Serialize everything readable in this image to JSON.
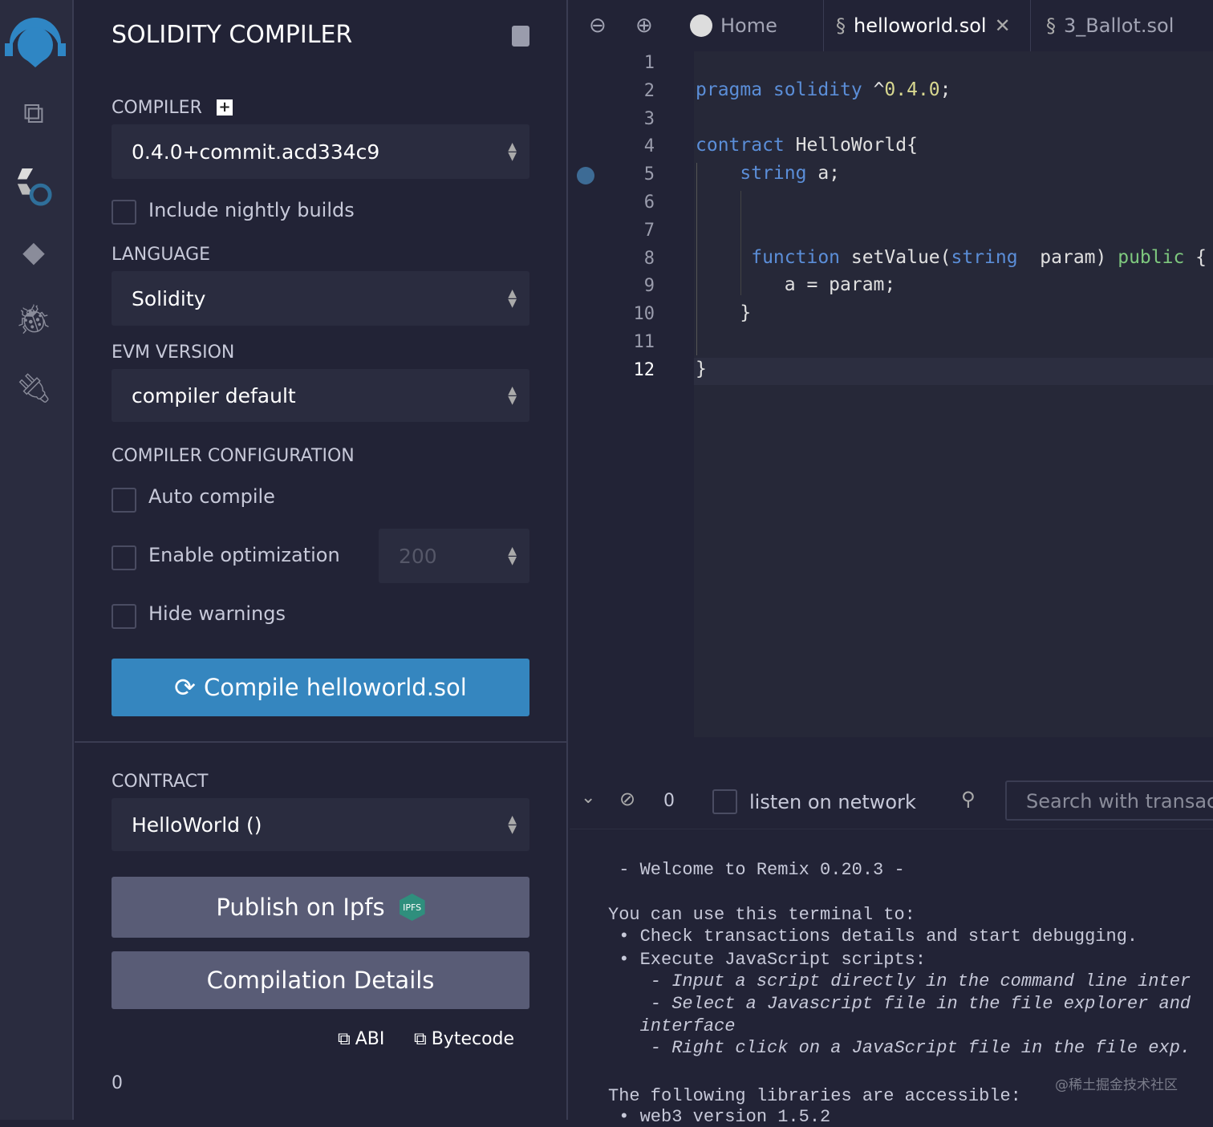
{
  "panel": {
    "title": "SOLIDITY COMPILER",
    "compiler_label": "COMPILER",
    "compiler_value": "0.4.0+commit.acd334c9",
    "nightly_label": "Include nightly builds",
    "language_label": "LANGUAGE",
    "language_value": "Solidity",
    "evm_label": "EVM VERSION",
    "evm_value": "compiler default",
    "config_label": "COMPILER CONFIGURATION",
    "auto_compile": "Auto compile",
    "enable_opt": "Enable optimization",
    "opt_runs": "200",
    "hide_warnings": "Hide warnings",
    "compile_button": "Compile helloworld.sol",
    "contract_label": "CONTRACT",
    "contract_value": "HelloWorld ()",
    "publish_button": "Publish on Ipfs",
    "ipfs_badge": "IPFS",
    "details_button": "Compilation Details",
    "abi_label": "ABI",
    "bytecode_label": "Bytecode",
    "bottom_count": "0"
  },
  "tabs": [
    {
      "label": "Home"
    },
    {
      "label": "helloworld.sol"
    },
    {
      "label": "3_Ballot.sol"
    }
  ],
  "colors": {
    "keyword": "#5b8ed8",
    "number": "#d8d890",
    "public": "#7ec87e",
    "accent": "#3586bf"
  },
  "code": [
    {
      "n": "1",
      "tokens": []
    },
    {
      "n": "2",
      "tokens": [
        {
          "t": "pragma solidity ",
          "k": "keyword"
        },
        {
          "t": "^",
          "k": "plain"
        },
        {
          "t": "0.4.0",
          "k": "number"
        },
        {
          "t": ";",
          "k": "plain"
        }
      ]
    },
    {
      "n": "3",
      "tokens": []
    },
    {
      "n": "4",
      "tokens": [
        {
          "t": "contract ",
          "k": "keyword"
        },
        {
          "t": "HelloWorld{",
          "k": "plain"
        }
      ]
    },
    {
      "n": "5",
      "tokens": [
        {
          "t": "    string",
          "k": "keyword"
        },
        {
          "t": " a;",
          "k": "plain"
        }
      ]
    },
    {
      "n": "6",
      "tokens": []
    },
    {
      "n": "7",
      "tokens": []
    },
    {
      "n": "8",
      "tokens": [
        {
          "t": "     function",
          "k": "keyword"
        },
        {
          "t": " setValue(",
          "k": "plain"
        },
        {
          "t": "string",
          "k": "keyword"
        },
        {
          "t": "  param) ",
          "k": "plain"
        },
        {
          "t": "public",
          "k": "public"
        },
        {
          "t": " {",
          "k": "plain"
        }
      ]
    },
    {
      "n": "9",
      "tokens": [
        {
          "t": "        a = param;",
          "k": "plain"
        }
      ]
    },
    {
      "n": "10",
      "tokens": [
        {
          "t": "    }",
          "k": "plain"
        }
      ]
    },
    {
      "n": "11",
      "tokens": []
    },
    {
      "n": "12",
      "tokens": [
        {
          "t": "}",
          "k": "plain"
        }
      ]
    }
  ],
  "terminal": {
    "count": "0",
    "listen_label": "listen on network",
    "search_placeholder": "Search with transac",
    "lines": [
      {
        "t": " - Welcome to Remix 0.20.3 -",
        "i": false
      },
      {
        "t": "",
        "i": false
      },
      {
        "t": "You can use this terminal to:",
        "i": false
      },
      {
        "t": " • Check transactions details and start debugging.",
        "i": false
      },
      {
        "t": " • Execute JavaScript scripts:",
        "i": false
      },
      {
        "t": "    - Input a script directly in the command line inter",
        "i": true
      },
      {
        "t": "    - Select a Javascript file in the file explorer and",
        "i": true
      },
      {
        "t": "   interface",
        "i": true
      },
      {
        "t": "    - Right click on a JavaScript file in the file exp.",
        "i": true
      },
      {
        "t": "",
        "i": false
      },
      {
        "t": "The following libraries are accessible:",
        "i": false
      },
      {
        "t": " • web3 version 1.5.2",
        "i": false
      }
    ],
    "watermark": "@稀土掘金技术社区"
  }
}
